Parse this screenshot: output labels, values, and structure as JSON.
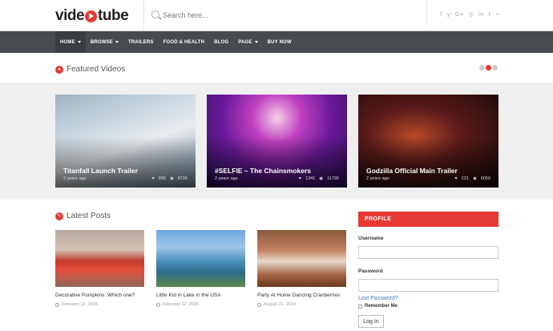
{
  "header": {
    "logo": {
      "pre": "vide",
      "post": "tube"
    },
    "search": {
      "placeholder": "Search here..."
    },
    "social": [
      {
        "name": "facebook-icon",
        "glyph": "f"
      },
      {
        "name": "twitter-icon",
        "glyph": "y"
      },
      {
        "name": "google-plus-icon",
        "glyph": "G+"
      },
      {
        "name": "instagram-icon",
        "glyph": "◎"
      },
      {
        "name": "linkedin-icon",
        "glyph": "in"
      },
      {
        "name": "tumblr-icon",
        "glyph": "t"
      },
      {
        "name": "rss-icon",
        "glyph": "⌁"
      }
    ]
  },
  "nav": {
    "items": [
      {
        "label": "HOME",
        "caret": true,
        "active": true
      },
      {
        "label": "BROWSE",
        "caret": true
      },
      {
        "label": "TRAILERS"
      },
      {
        "label": "FOOD & HEALTH"
      },
      {
        "label": "BLOG"
      },
      {
        "label": "PAGE",
        "caret": true
      },
      {
        "label": "BUY NOW"
      }
    ]
  },
  "featured": {
    "title": "Featured Videos",
    "icon": "star-icon",
    "slider_dots": 3,
    "active_dot": 1,
    "cards": [
      {
        "title": "Titanfall Launch Trailer",
        "date": "2 years ago",
        "likes": "895",
        "views": "8726"
      },
      {
        "title": "#SELFIE – The Chainsmokers",
        "date": "2 years ago",
        "likes": "1341",
        "views": "11790"
      },
      {
        "title": "Godzilla Official Main Trailer",
        "date": "2 years ago",
        "likes": "221",
        "views": "6059"
      }
    ]
  },
  "latest": {
    "title": "Latest Posts",
    "icon": "pencil-icon",
    "posts": [
      {
        "title": "Decorative Pumpkins: Which one?",
        "date": "February 12 ,2015"
      },
      {
        "title": "Little Kid in Lake in the USA",
        "date": "February 12 ,2015"
      },
      {
        "title": "Party At Home Dancing Cranberries",
        "date": "August 21 ,2014"
      }
    ]
  },
  "profile": {
    "heading": "PROFILE",
    "username_label": "Username",
    "password_label": "Password",
    "lost_password": "Lost Password?",
    "remember_me": "Remember Me",
    "login": "Log In"
  },
  "colors": {
    "accent": "#e53935",
    "nav_bg": "#474a4f",
    "band_bg": "#efefef",
    "link": "#3a7bbf"
  }
}
